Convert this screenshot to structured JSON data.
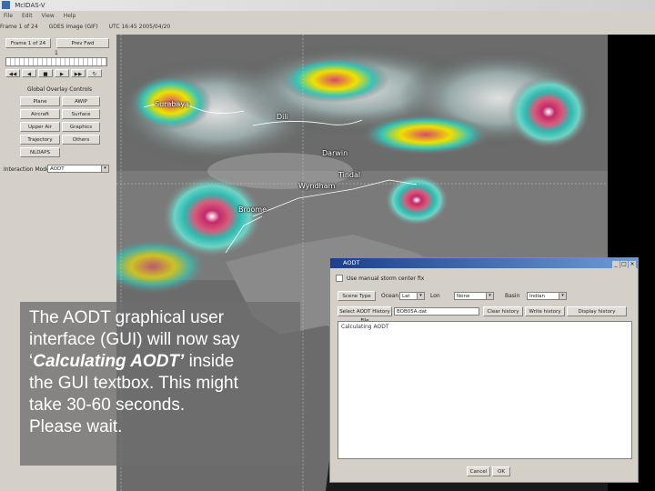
{
  "window": {
    "title": "McIDAS-V"
  },
  "menu": [
    "File",
    "Edit",
    "View",
    "Help"
  ],
  "infobar": {
    "items": [
      "Frame 1 of 24",
      "GOES Image (GIF)",
      "UTC 16:45 2005/04/20"
    ]
  },
  "controls": {
    "top_button": "Frame 1 of 24",
    "top_button2": "Prev  Fwd",
    "slider_value": "1",
    "overlay_header": "Global Overlay Controls",
    "overlay_buttons": [
      "Plane",
      "AWIP",
      "Aircraft",
      "Surface",
      "Upper Air",
      "Graphics",
      "Trajectory",
      "Others",
      "NLDAPS"
    ],
    "interaction_label": "Interaction Mode",
    "interaction_value": "AODT"
  },
  "map": {
    "cities": [
      "Surabaya",
      "Dili",
      "Darwin",
      "Tindal",
      "Wyndham",
      "Broome"
    ]
  },
  "caption": {
    "line1": "The AODT graphical user",
    "line2": "interface (GUI) will now say",
    "line3_quote_open": "‘",
    "line3_em": "Calculating AODT’",
    "line3_rest": " inside",
    "line4": "the GUI textbox. This might",
    "line5": "take 30-60 seconds.",
    "line6": "Please wait."
  },
  "aodt": {
    "title": "AODT",
    "checkbox_label": "Use manual storm center fix",
    "scene_button": "Scene Type",
    "select1_label": "Ocean",
    "select1_value": "Lat",
    "select2_label": "Lon",
    "select2_value": "None",
    "select3_label": "Basin",
    "select3_value": "Indian",
    "history_label": "Select AODT History File",
    "history_value": "BOB05A.dat",
    "buttons": [
      "Clear history",
      "Write history",
      "Display history"
    ],
    "textbox": "Calculating AODT",
    "ok_button": "Cancel",
    "ok2_button": "OK"
  }
}
